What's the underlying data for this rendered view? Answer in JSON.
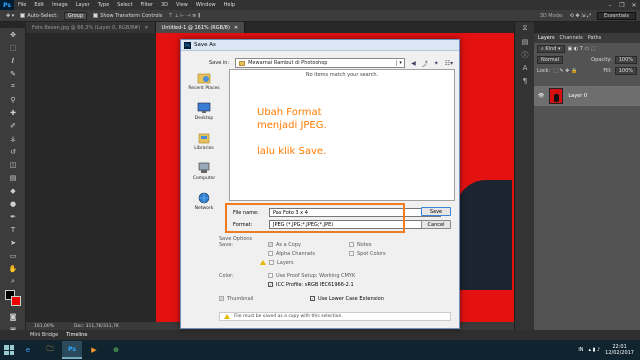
{
  "app": {
    "logo": "Ps",
    "menu": [
      "File",
      "Edit",
      "Image",
      "Layer",
      "Type",
      "Select",
      "Filter",
      "3D",
      "View",
      "Window",
      "Help"
    ],
    "window_controls": [
      "–",
      "❐",
      "✕"
    ]
  },
  "options_bar": {
    "auto_select_label": "Auto-Select:",
    "auto_select_value": "Group",
    "show_transform_label": "Show Transform Controls",
    "mode_3d_label": "3D Mode:",
    "workspace": "Essentials"
  },
  "doc_tabs": [
    {
      "label": "Foto Besen.jpg @ 66,3% (Layer 0, RGB/8#)",
      "close": "✕"
    },
    {
      "label": "Untitled-1 @ 161% (RGB/8)",
      "close": "✕"
    }
  ],
  "status_bar": {
    "zoom": "161,00%",
    "doc_size": "Doc: 311,7K/311,7K"
  },
  "timeline_tabs": [
    "Mini Bridge",
    "Timeline"
  ],
  "layers_panel": {
    "tabs": [
      "Layers",
      "Channels",
      "Paths"
    ],
    "kind_label": "Kind",
    "blend_mode": "Normal",
    "opacity_label": "Opacity:",
    "opacity_value": "100%",
    "lock_label": "Lock:",
    "fill_label": "Fill:",
    "fill_value": "100%",
    "layer_name": "Layer 0"
  },
  "dialog": {
    "title": "Save As",
    "save_in_label": "Save in:",
    "save_in_folder": "Mewarnai Rambut di Photoshop",
    "empty_message": "No items match your search.",
    "places": [
      "Recent Places",
      "Desktop",
      "Libraries",
      "Computer",
      "Network"
    ],
    "file_name_label": "File name:",
    "file_name_value": "Pas Foto 3 x 4",
    "format_label": "Format:",
    "format_value": "JPEG (*.JPG;*.JPEG;*.JPE)",
    "save_button": "Save",
    "cancel_button": "Cancel",
    "save_options_label": "Save Options",
    "save_label": "Save:",
    "as_copy": "As a Copy",
    "notes": "Notes",
    "alpha_channels": "Alpha Channels",
    "spot_colors": "Spot Colors",
    "layers": "Layers",
    "color_label": "Color:",
    "use_proof_setup": "Use Proof Setup:  Working CMYK",
    "icc_profile": "ICC Profile:  sRGB IEC61966-2.1",
    "thumbnail": "Thumbnail",
    "lower_case_ext": "Use Lower Case Extension",
    "warning": "File must be saved as a copy with this selection."
  },
  "annotation": {
    "line1": "Ubah Format",
    "line2": "menjadi JPEG.",
    "line3": "lalu klik Save.",
    "color": "#ff7a00"
  },
  "taskbar": {
    "apps": [
      "e",
      "🗀",
      "Ps",
      "▶",
      "⊕"
    ],
    "lang": "IN",
    "time": "22:01",
    "date": "12/02/2017"
  }
}
